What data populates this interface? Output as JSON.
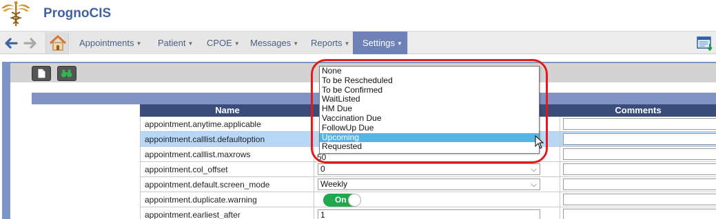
{
  "app": {
    "title": "PrognoCIS"
  },
  "nav": {
    "menus": [
      {
        "label": "Appointments",
        "active": false
      },
      {
        "label": "Patient",
        "active": false
      },
      {
        "label": "CPOE",
        "active": false
      },
      {
        "label": "Messages",
        "active": false
      },
      {
        "label": "Reports",
        "active": false
      },
      {
        "label": "Settings",
        "active": true
      }
    ]
  },
  "table": {
    "headers": {
      "name": "Name",
      "comments": "Comments"
    },
    "rows": [
      {
        "name": "appointment.anytime.applicable",
        "control": "text",
        "value": ""
      },
      {
        "name": "appointment.calllist.defaultoption",
        "control": "select",
        "value": "",
        "selected": true
      },
      {
        "name": "appointment.calllist.maxrows",
        "control": "text",
        "value": "50"
      },
      {
        "name": "appointment.col_offset",
        "control": "select",
        "value": "0"
      },
      {
        "name": "appointment.default.screen_mode",
        "control": "select",
        "value": "Weekly"
      },
      {
        "name": "appointment.duplicate.warning",
        "control": "toggle",
        "value": "On"
      },
      {
        "name": "appointment.earliest_after",
        "control": "text",
        "value": "1"
      }
    ]
  },
  "dropdown": {
    "options": [
      "None",
      "To be Rescheduled",
      "To be Confirmed",
      "WaitListed",
      "HM Due",
      "Vaccination Due",
      "FollowUp Due",
      "Upcoming",
      "Requested"
    ],
    "highlighted": "Upcoming"
  },
  "colors": {
    "accent": "#6e82b8",
    "header": "#3a4d7a",
    "highlight": "#57b3e3",
    "annotation": "#e01b1b",
    "toggle_on": "#1fa84e"
  }
}
